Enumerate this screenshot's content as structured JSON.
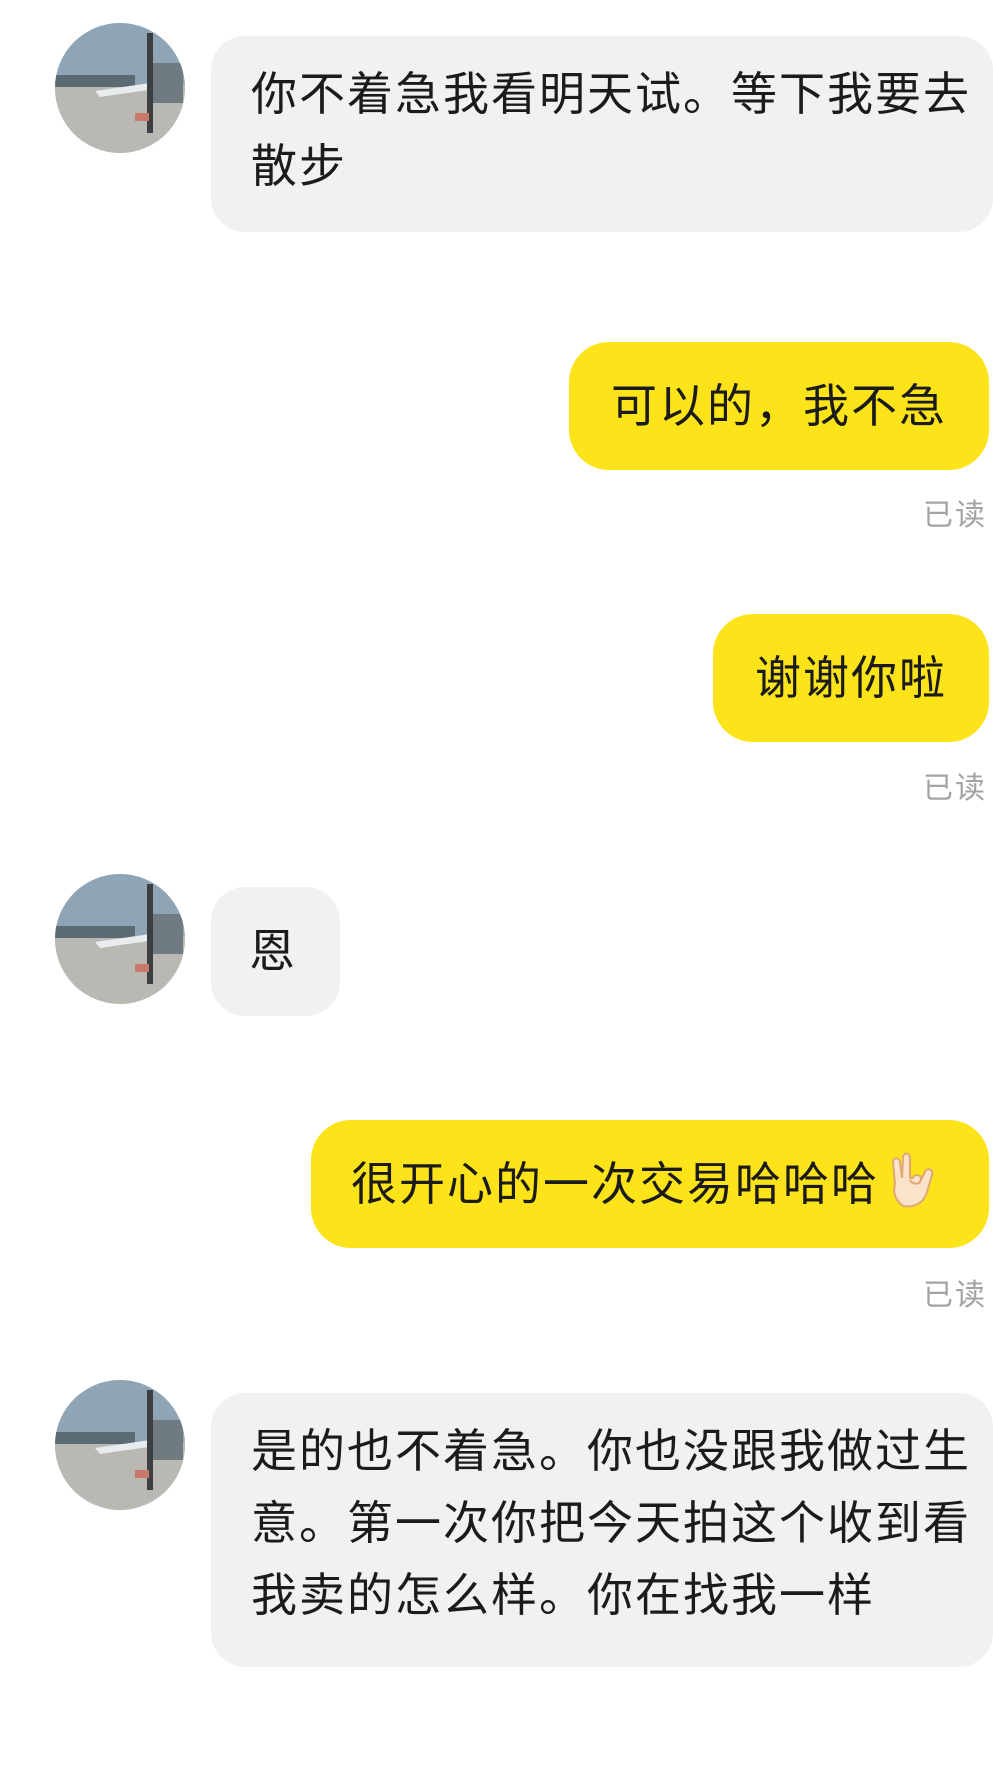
{
  "messages": [
    {
      "direction": "incoming",
      "text": "你不着急我看明天试。等下我要去散步"
    },
    {
      "direction": "outgoing",
      "text": "可以的，我不急",
      "status": "已读"
    },
    {
      "direction": "outgoing",
      "text": "谢谢你啦",
      "status": "已读"
    },
    {
      "direction": "incoming",
      "text": "恩"
    },
    {
      "direction": "outgoing",
      "text": "很开心的一次交易哈哈哈",
      "emoji": "love-you-hand-gesture-icon",
      "status": "已读"
    },
    {
      "direction": "incoming",
      "text": "是的也不着急。你也没跟我做过生意。第一次你把今天拍这个收到看我卖的怎么样。你在找我一样"
    }
  ],
  "colors": {
    "incoming_bubble": "#f1f1f3",
    "outgoing_bubble": "#fde31a",
    "read_status": "#a3a3a3"
  }
}
